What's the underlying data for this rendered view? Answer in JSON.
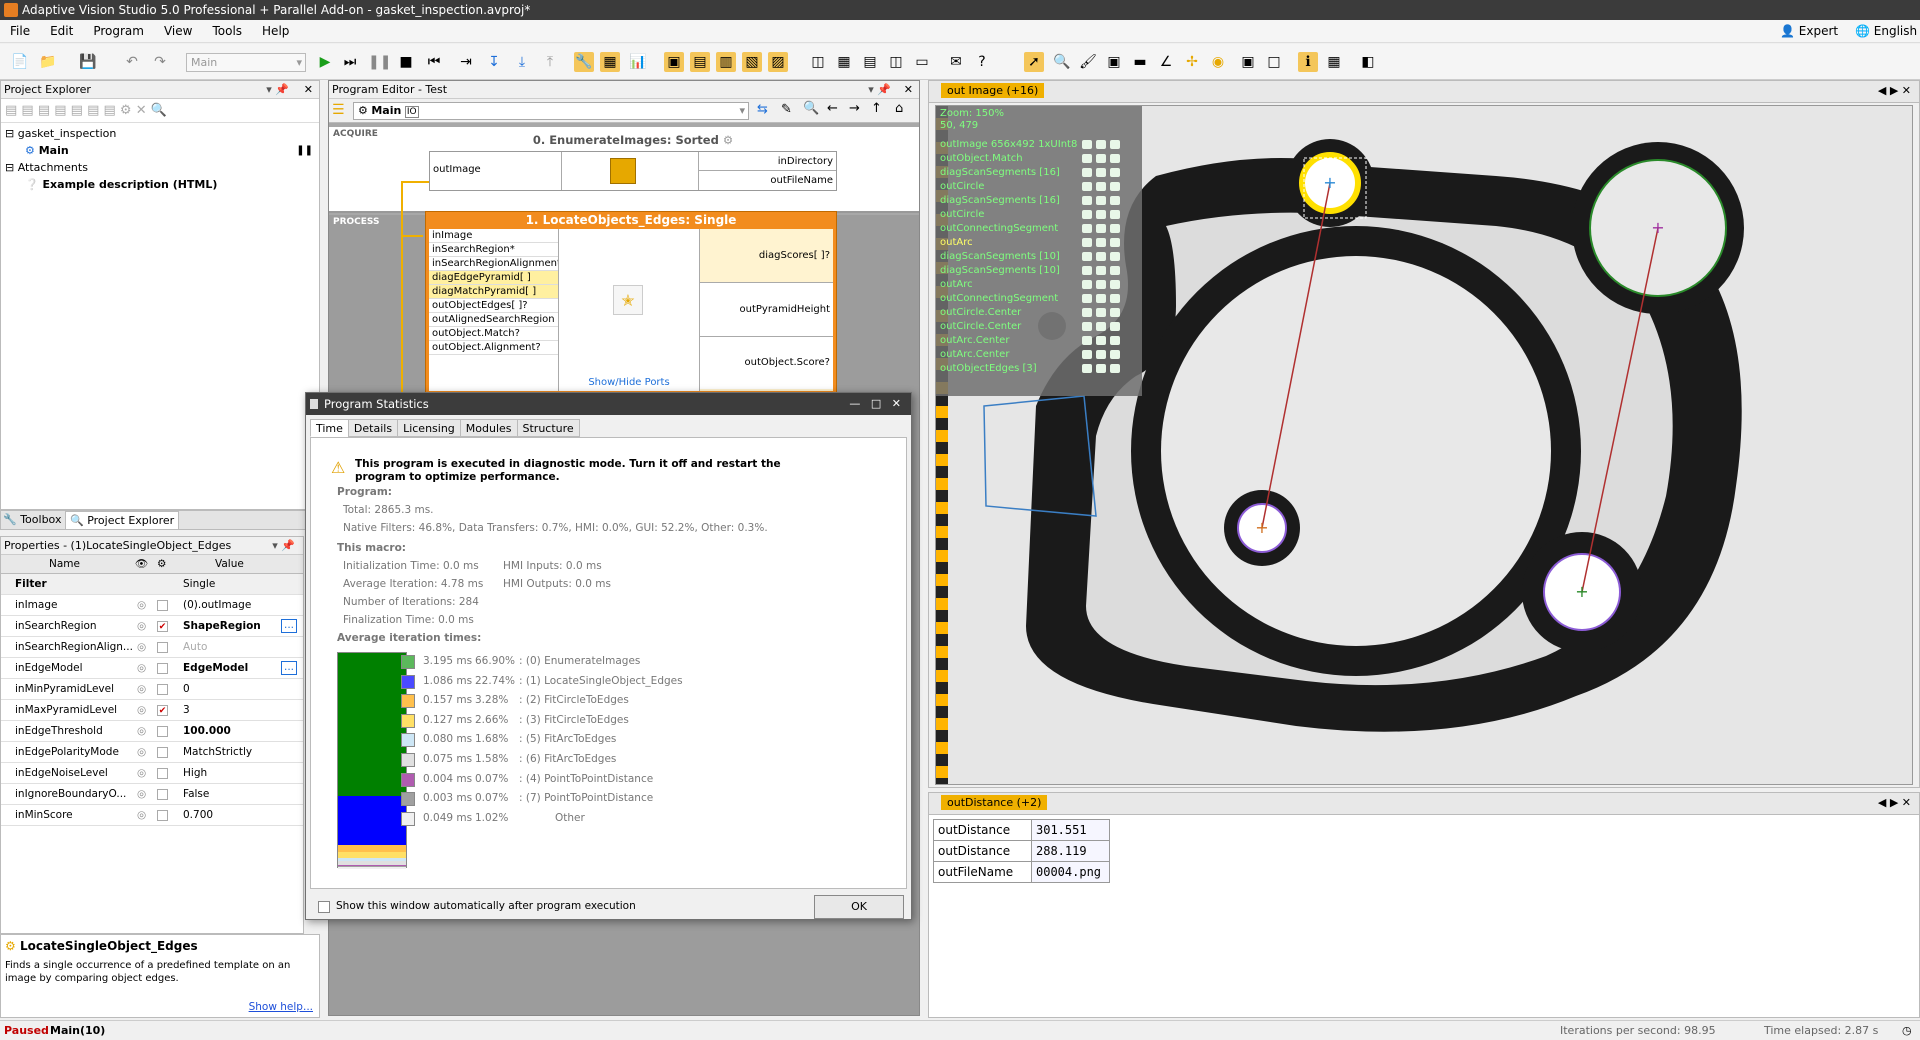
{
  "window": {
    "title": "Adaptive Vision Studio 5.0 Professional + Parallel Add-on - gasket_inspection.avproj*"
  },
  "menu": {
    "items": [
      "File",
      "Edit",
      "Program",
      "View",
      "Tools",
      "Help"
    ],
    "expert": "Expert",
    "language": "English"
  },
  "toolbar": {
    "macro_select": "Main"
  },
  "project_explorer": {
    "title": "Project Explorer",
    "root": "gasket_inspection",
    "main": "Main",
    "attachments": "Attachments",
    "attachment_item": "Example description (HTML)"
  },
  "bottom_tabs": {
    "toolbox": "Toolbox",
    "project_explorer": "Project Explorer"
  },
  "properties": {
    "title": "Properties - (1)LocateSingleObject_Edges",
    "headers": {
      "name": "Name",
      "value": "Value"
    },
    "rows": [
      {
        "name": "Filter",
        "value": "Single",
        "bold": true
      },
      {
        "name": "inImage",
        "value": "(0).outImage"
      },
      {
        "name": "inSearchRegion",
        "value": "ShapeRegion",
        "checked": true,
        "dots": true,
        "bold_value": true
      },
      {
        "name": "inSearchRegionAlign...",
        "value": "Auto",
        "grey": true
      },
      {
        "name": "inEdgeModel",
        "value": "EdgeModel",
        "dots": true,
        "bold_value": true
      },
      {
        "name": "inMinPyramidLevel",
        "value": "0"
      },
      {
        "name": "inMaxPyramidLevel",
        "value": "3",
        "checked": true
      },
      {
        "name": "inEdgeThreshold",
        "value": "100.000",
        "bold_value": true
      },
      {
        "name": "inEdgePolarityMode",
        "value": "MatchStrictly"
      },
      {
        "name": "inEdgeNoiseLevel",
        "value": "High"
      },
      {
        "name": "inIgnoreBoundaryO...",
        "value": "False"
      },
      {
        "name": "inMinScore",
        "value": "0.700"
      }
    ]
  },
  "help": {
    "title": "LocateSingleObject_Edges",
    "text": "Finds a single occurrence of a predefined template on an image by comparing object edges.",
    "link": "Show help..."
  },
  "program_editor": {
    "title": "Program Editor - Test",
    "macro": "Main",
    "acquire": "ACQUIRE",
    "process": "PROCESS",
    "node0": {
      "title": "0. EnumerateImages: Sorted",
      "in": "outImage",
      "outs": [
        "inDirectory",
        "outFileName"
      ]
    },
    "node1": {
      "title": "1. LocateObjects_Edges: Single",
      "inputs": [
        "inImage",
        "inSearchRegion*",
        "inSearchRegionAlignment*",
        "diagEdgePyramid[ ]",
        "diagMatchPyramid[ ]",
        "outObjectEdges[ ]?",
        "outAlignedSearchRegion",
        "outObject.Match?",
        "outObject.Alignment?"
      ],
      "outputs": [
        "diagScores[ ]?",
        "outPyramidHeight",
        "outObject.Score?"
      ],
      "show_hide": "Show/Hide Ports"
    }
  },
  "image_view": {
    "tab": "out Image (+16)",
    "zoom": "Zoom: 150%",
    "coords": "50, 479",
    "overlay": [
      "outImage 656x492 1xUInt8",
      "outObject.Match",
      "diagScanSegments [16]",
      "outCircle",
      "diagScanSegments [16]",
      "outCircle",
      "outConnectingSegment",
      "outArc",
      "diagScanSegments [10]",
      "diagScanSegments [10]",
      "outArc",
      "outConnectingSegment",
      "outCircle.Center",
      "outCircle.Center",
      "outArc.Center",
      "outArc.Center",
      "outObjectEdges [3]"
    ]
  },
  "data_view": {
    "tab": "outDistance (+2)",
    "rows": [
      {
        "name": "outDistance",
        "value": "301.551"
      },
      {
        "name": "outDistance",
        "value": "288.119"
      },
      {
        "name": "outFileName",
        "value": "00004.png"
      }
    ]
  },
  "stats": {
    "title": "Program Statistics",
    "tabs": [
      "Time",
      "Details",
      "Licensing",
      "Modules",
      "Structure"
    ],
    "warning": "This program is executed in diagnostic mode. Turn it off and restart the program to optimize performance.",
    "program_label": "Program:",
    "total": "Total: 2865.3 ms.",
    "native": "Native Filters: 46.8%, Data Transfers: 0.7%, HMI: 0.0%, GUI: 52.2%, Other: 0.3%.",
    "macro_label": "This macro:",
    "init": "Initialization Time: 0.0 ms",
    "hmi_in": "HMI Inputs: 0.0 ms",
    "avg": "Average Iteration: 4.78 ms",
    "hmi_out": "HMI Outputs: 0.0 ms",
    "iters": "Number of Iterations: 284",
    "final": "Finalization Time: 0.0 ms",
    "avg_label": "Average iteration times:",
    "legend": [
      {
        "ms": "3.195 ms",
        "pct": "66.90%",
        "name": ": (0) EnumerateImages",
        "color": "#5cb85c"
      },
      {
        "ms": "1.086 ms",
        "pct": "22.74%",
        "name": ": (1) LocateSingleObject_Edges",
        "color": "#4a4aff"
      },
      {
        "ms": "0.157 ms",
        "pct": "3.28%",
        "name": ": (2) FitCircleToEdges",
        "color": "#ffc04d"
      },
      {
        "ms": "0.127 ms",
        "pct": "2.66%",
        "name": ": (3) FitCircleToEdges",
        "color": "#ffe066"
      },
      {
        "ms": "0.080 ms",
        "pct": "1.68%",
        "name": ": (5) FitArcToEdges",
        "color": "#cde6f5"
      },
      {
        "ms": "0.075 ms",
        "pct": "1.58%",
        "name": ": (6) FitArcToEdges",
        "color": "#e0e0e0"
      },
      {
        "ms": "0.004 ms",
        "pct": "0.07%",
        "name": ": (4) PointToPointDistance",
        "color": "#b05cb0"
      },
      {
        "ms": "0.003 ms",
        "pct": "0.07%",
        "name": ": (7) PointToPointDistance",
        "color": "#a0a0a0"
      },
      {
        "ms": "0.049 ms",
        "pct": "1.02%",
        "name": "Other",
        "color": "#f0f0f0"
      }
    ],
    "bar_fractions": [
      0.669,
      0.2274,
      0.0328,
      0.0266,
      0.0168,
      0.0158,
      0.0007,
      0.0007,
      0.0102
    ],
    "checkbox": "Show this window automatically after program execution",
    "ok": "OK"
  },
  "status": {
    "paused": "Paused",
    "main": "Main(10)",
    "ips": "Iterations per second: 98.95",
    "elapsed": "Time elapsed: 2.87 s"
  }
}
